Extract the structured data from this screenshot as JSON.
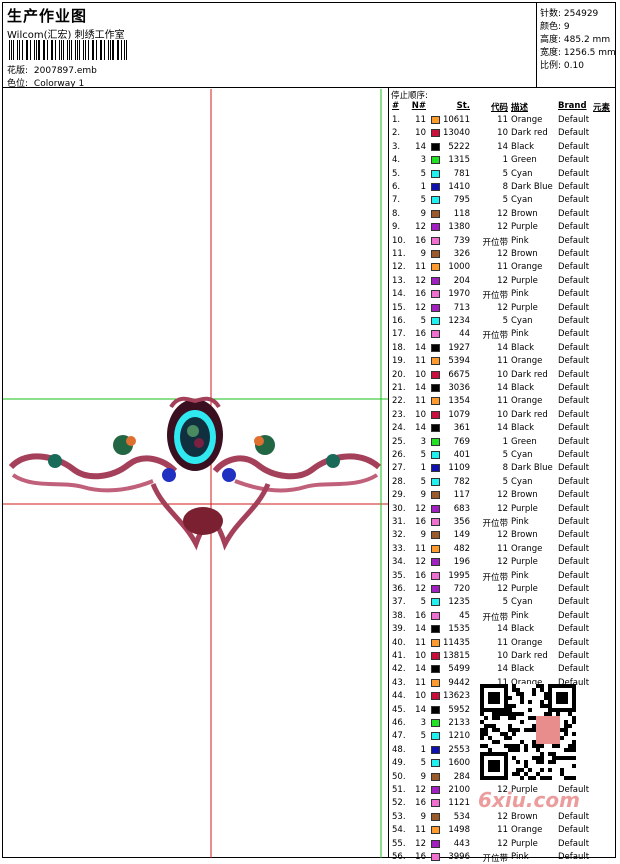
{
  "header": {
    "title": "生产作业图",
    "company": "Wilcom(汇宏) 刺绣工作室",
    "design_label": "花版:",
    "design_value": "2007897.emb",
    "colorway_label": "色位:",
    "colorway_value": "Colorway 1"
  },
  "specs": [
    {
      "label": "针数:",
      "value": "254929"
    },
    {
      "label": "颜色:",
      "value": "9"
    },
    {
      "label": "高度:",
      "value": "485.2 mm"
    },
    {
      "label": "宽度:",
      "value": "1256.5 mm"
    },
    {
      "label": "比例:",
      "value": "0.10"
    }
  ],
  "table": {
    "caption": "停止顺序:",
    "headers": {
      "idx": "#",
      "n": "N#",
      "st": "St.",
      "code": "代码",
      "desc": "描述",
      "brand": "Brand",
      "extra": "元素"
    },
    "rows": [
      {
        "i": "1.",
        "n": "11",
        "st": "10611",
        "code": "11",
        "desc": "Orange",
        "brand": "Default",
        "color": "#ff9a2e"
      },
      {
        "i": "2.",
        "n": "10",
        "st": "13040",
        "code": "10",
        "desc": "Dark red",
        "brand": "Default",
        "color": "#c8103a"
      },
      {
        "i": "3.",
        "n": "14",
        "st": "5222",
        "code": "14",
        "desc": "Black",
        "brand": "Default",
        "color": "#000000"
      },
      {
        "i": "4.",
        "n": "3",
        "st": "1315",
        "code": "1",
        "desc": "Green",
        "brand": "Default",
        "color": "#22e022"
      },
      {
        "i": "5.",
        "n": "5",
        "st": "781",
        "code": "5",
        "desc": "Cyan",
        "brand": "Default",
        "color": "#20f0f0"
      },
      {
        "i": "6.",
        "n": "1",
        "st": "1410",
        "code": "8",
        "desc": "Dark Blue",
        "brand": "Default",
        "color": "#1010b0"
      },
      {
        "i": "7.",
        "n": "5",
        "st": "795",
        "code": "5",
        "desc": "Cyan",
        "brand": "Default",
        "color": "#20f0f0"
      },
      {
        "i": "8.",
        "n": "9",
        "st": "118",
        "code": "12",
        "desc": "Brown",
        "brand": "Default",
        "color": "#9a5a2a"
      },
      {
        "i": "9.",
        "n": "12",
        "st": "1380",
        "code": "12",
        "desc": "Purple",
        "brand": "Default",
        "color": "#a020c0"
      },
      {
        "i": "10.",
        "n": "16",
        "st": "739",
        "code": "开位带",
        "desc": "Pink",
        "brand": "Default",
        "color": "#f070d0"
      },
      {
        "i": "11.",
        "n": "9",
        "st": "326",
        "code": "12",
        "desc": "Brown",
        "brand": "Default",
        "color": "#9a5a2a"
      },
      {
        "i": "12.",
        "n": "11",
        "st": "1000",
        "code": "11",
        "desc": "Orange",
        "brand": "Default",
        "color": "#ff9a2e"
      },
      {
        "i": "13.",
        "n": "12",
        "st": "204",
        "code": "12",
        "desc": "Purple",
        "brand": "Default",
        "color": "#a020c0"
      },
      {
        "i": "14.",
        "n": "16",
        "st": "1970",
        "code": "开位带",
        "desc": "Pink",
        "brand": "Default",
        "color": "#f070d0"
      },
      {
        "i": "15.",
        "n": "12",
        "st": "713",
        "code": "12",
        "desc": "Purple",
        "brand": "Default",
        "color": "#a020c0"
      },
      {
        "i": "16.",
        "n": "5",
        "st": "1234",
        "code": "5",
        "desc": "Cyan",
        "brand": "Default",
        "color": "#20f0f0"
      },
      {
        "i": "17.",
        "n": "16",
        "st": "44",
        "code": "开位带",
        "desc": "Pink",
        "brand": "Default",
        "color": "#f070d0"
      },
      {
        "i": "18.",
        "n": "14",
        "st": "1927",
        "code": "14",
        "desc": "Black",
        "brand": "Default",
        "color": "#000000"
      },
      {
        "i": "19.",
        "n": "11",
        "st": "5394",
        "code": "11",
        "desc": "Orange",
        "brand": "Default",
        "color": "#ff9a2e"
      },
      {
        "i": "20.",
        "n": "10",
        "st": "6675",
        "code": "10",
        "desc": "Dark red",
        "brand": "Default",
        "color": "#c8103a"
      },
      {
        "i": "21.",
        "n": "14",
        "st": "3036",
        "code": "14",
        "desc": "Black",
        "brand": "Default",
        "color": "#000000"
      },
      {
        "i": "22.",
        "n": "11",
        "st": "1354",
        "code": "11",
        "desc": "Orange",
        "brand": "Default",
        "color": "#ff9a2e"
      },
      {
        "i": "23.",
        "n": "10",
        "st": "1079",
        "code": "10",
        "desc": "Dark red",
        "brand": "Default",
        "color": "#c8103a"
      },
      {
        "i": "24.",
        "n": "14",
        "st": "361",
        "code": "14",
        "desc": "Black",
        "brand": "Default",
        "color": "#000000"
      },
      {
        "i": "25.",
        "n": "3",
        "st": "769",
        "code": "1",
        "desc": "Green",
        "brand": "Default",
        "color": "#22e022"
      },
      {
        "i": "26.",
        "n": "5",
        "st": "401",
        "code": "5",
        "desc": "Cyan",
        "brand": "Default",
        "color": "#20f0f0"
      },
      {
        "i": "27.",
        "n": "1",
        "st": "1109",
        "code": "8",
        "desc": "Dark Blue",
        "brand": "Default",
        "color": "#1010b0"
      },
      {
        "i": "28.",
        "n": "5",
        "st": "782",
        "code": "5",
        "desc": "Cyan",
        "brand": "Default",
        "color": "#20f0f0"
      },
      {
        "i": "29.",
        "n": "9",
        "st": "117",
        "code": "12",
        "desc": "Brown",
        "brand": "Default",
        "color": "#9a5a2a"
      },
      {
        "i": "30.",
        "n": "12",
        "st": "683",
        "code": "12",
        "desc": "Purple",
        "brand": "Default",
        "color": "#a020c0"
      },
      {
        "i": "31.",
        "n": "16",
        "st": "356",
        "code": "开位带",
        "desc": "Pink",
        "brand": "Default",
        "color": "#f070d0"
      },
      {
        "i": "32.",
        "n": "9",
        "st": "149",
        "code": "12",
        "desc": "Brown",
        "brand": "Default",
        "color": "#9a5a2a"
      },
      {
        "i": "33.",
        "n": "11",
        "st": "482",
        "code": "11",
        "desc": "Orange",
        "brand": "Default",
        "color": "#ff9a2e"
      },
      {
        "i": "34.",
        "n": "12",
        "st": "196",
        "code": "12",
        "desc": "Purple",
        "brand": "Default",
        "color": "#a020c0"
      },
      {
        "i": "35.",
        "n": "16",
        "st": "1995",
        "code": "开位带",
        "desc": "Pink",
        "brand": "Default",
        "color": "#f070d0"
      },
      {
        "i": "36.",
        "n": "12",
        "st": "720",
        "code": "12",
        "desc": "Purple",
        "brand": "Default",
        "color": "#a020c0"
      },
      {
        "i": "37.",
        "n": "5",
        "st": "1235",
        "code": "5",
        "desc": "Cyan",
        "brand": "Default",
        "color": "#20f0f0"
      },
      {
        "i": "38.",
        "n": "16",
        "st": "45",
        "code": "开位带",
        "desc": "Pink",
        "brand": "Default",
        "color": "#f070d0"
      },
      {
        "i": "39.",
        "n": "14",
        "st": "1535",
        "code": "14",
        "desc": "Black",
        "brand": "Default",
        "color": "#000000"
      },
      {
        "i": "40.",
        "n": "11",
        "st": "11435",
        "code": "11",
        "desc": "Orange",
        "brand": "Default",
        "color": "#ff9a2e"
      },
      {
        "i": "41.",
        "n": "10",
        "st": "13815",
        "code": "10",
        "desc": "Dark red",
        "brand": "Default",
        "color": "#c8103a"
      },
      {
        "i": "42.",
        "n": "14",
        "st": "5499",
        "code": "14",
        "desc": "Black",
        "brand": "Default",
        "color": "#000000"
      },
      {
        "i": "43.",
        "n": "11",
        "st": "9442",
        "code": "11",
        "desc": "Orange",
        "brand": "Default",
        "color": "#ff9a2e"
      },
      {
        "i": "44.",
        "n": "10",
        "st": "13623",
        "code": "",
        "desc": "",
        "brand": "",
        "color": "#c8103a"
      },
      {
        "i": "45.",
        "n": "14",
        "st": "5952",
        "code": "",
        "desc": "",
        "brand": "",
        "color": "#000000"
      },
      {
        "i": "46.",
        "n": "3",
        "st": "2133",
        "code": "",
        "desc": "",
        "brand": "",
        "color": "#22e022"
      },
      {
        "i": "47.",
        "n": "5",
        "st": "1210",
        "code": "",
        "desc": "",
        "brand": "",
        "color": "#20f0f0"
      },
      {
        "i": "48.",
        "n": "1",
        "st": "2553",
        "code": "",
        "desc": "",
        "brand": "",
        "color": "#1010b0"
      },
      {
        "i": "49.",
        "n": "5",
        "st": "1600",
        "code": "",
        "desc": "",
        "brand": "",
        "color": "#20f0f0"
      },
      {
        "i": "50.",
        "n": "9",
        "st": "284",
        "code": "",
        "desc": "",
        "brand": "",
        "color": "#9a5a2a"
      },
      {
        "i": "51.",
        "n": "12",
        "st": "2100",
        "code": "12",
        "desc": "Purple",
        "brand": "Default",
        "color": "#a020c0"
      },
      {
        "i": "52.",
        "n": "16",
        "st": "1121",
        "code": "",
        "desc": "",
        "brand": "",
        "color": "#f070d0"
      },
      {
        "i": "53.",
        "n": "9",
        "st": "534",
        "code": "12",
        "desc": "Brown",
        "brand": "Default",
        "color": "#9a5a2a"
      },
      {
        "i": "54.",
        "n": "11",
        "st": "1498",
        "code": "11",
        "desc": "Orange",
        "brand": "Default",
        "color": "#ff9a2e"
      },
      {
        "i": "55.",
        "n": "12",
        "st": "443",
        "code": "12",
        "desc": "Purple",
        "brand": "Default",
        "color": "#a020c0"
      },
      {
        "i": "56.",
        "n": "16",
        "st": "3996",
        "code": "开位带",
        "desc": "Pink",
        "brand": "Default",
        "color": "#f070d0"
      }
    ]
  },
  "watermark": "6xiu.com",
  "colors": {
    "guide_red": "#d11a1a",
    "guide_green": "#18c018",
    "motif_main": "#a4405a"
  }
}
